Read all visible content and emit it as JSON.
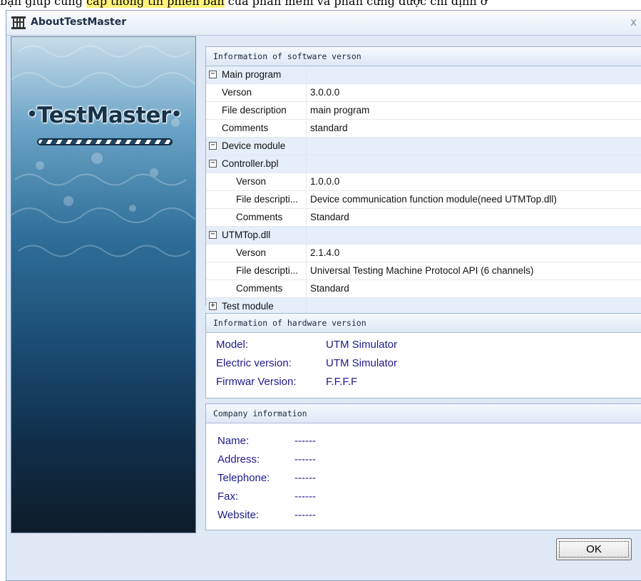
{
  "top_strip": {
    "text_before": "bạn giúp cung ",
    "highlighted": "cấp thông tin phiên bản",
    "text_after": " của phần mềm và phần cứng được chỉ định ở"
  },
  "window": {
    "title": "AboutTestMaster",
    "close_glyph": "x"
  },
  "banner": {
    "brand_text": "TestMaster",
    "dot": "•"
  },
  "software": {
    "header": "Information of software verson",
    "rows": [
      {
        "level": 0,
        "toggle": "−",
        "name": "Main program",
        "value": ""
      },
      {
        "level": 1,
        "name": "Verson",
        "value": "3.0.0.0"
      },
      {
        "level": 1,
        "name": "File description",
        "value": "main program"
      },
      {
        "level": 1,
        "name": "Comments",
        "value": "standard"
      },
      {
        "level": 0,
        "toggle": "−",
        "name": "Device module",
        "value": ""
      },
      {
        "level": 0,
        "toggle": "−",
        "name": "Controller.bpl",
        "value": ""
      },
      {
        "level": 2,
        "name": "Verson",
        "value": "1.0.0.0"
      },
      {
        "level": 2,
        "name": "File descripti...",
        "value": "Device communication function module(need UTMTop.dll)"
      },
      {
        "level": 2,
        "name": "Comments",
        "value": "Standard"
      },
      {
        "level": 0,
        "toggle": "−",
        "name": "UTMTop.dll",
        "value": ""
      },
      {
        "level": 2,
        "name": "Verson",
        "value": "2.1.4.0"
      },
      {
        "level": 2,
        "name": "File descripti...",
        "value": "Universal Testing Machine Protocol API (6 channels)"
      },
      {
        "level": 2,
        "name": "Comments",
        "value": "Standard"
      },
      {
        "level": 0,
        "toggle": "+",
        "name": "Test module",
        "value": ""
      }
    ]
  },
  "hardware": {
    "header": "Information of hardware version",
    "rows": [
      {
        "label": "Model:",
        "value": "UTM Simulator"
      },
      {
        "label": "Electric version:",
        "value": "UTM Simulator"
      },
      {
        "label": "Firmwar Version:",
        "value": "F.F.F.F"
      }
    ]
  },
  "company": {
    "header": "Company information",
    "rows": [
      {
        "label": "Name:",
        "value": "------"
      },
      {
        "label": "Address:",
        "value": "------"
      },
      {
        "label": "Telephone:",
        "value": "------"
      },
      {
        "label": "Fax:",
        "value": "------"
      },
      {
        "label": "Website:",
        "value": "------"
      }
    ]
  },
  "buttons": {
    "ok": "OK"
  }
}
